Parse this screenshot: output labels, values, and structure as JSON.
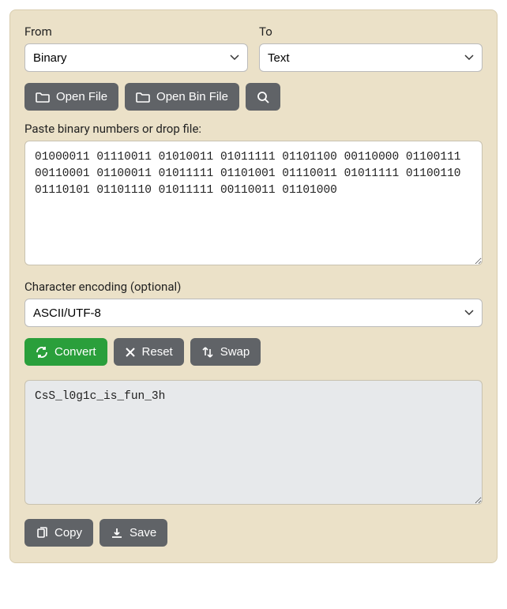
{
  "from": {
    "label": "From",
    "value": "Binary"
  },
  "to": {
    "label": "To",
    "value": "Text"
  },
  "buttons": {
    "open_file": "Open File",
    "open_bin_file": "Open Bin File"
  },
  "input": {
    "label": "Paste binary numbers or drop file:",
    "value": "01000011 01110011 01010011 01011111 01101100 00110000 01100111 00110001 01100011 01011111 01101001 01110011 01011111 01100110 01110101 01101110 01011111 00110011 01101000"
  },
  "encoding": {
    "label": "Character encoding (optional)",
    "value": "ASCII/UTF-8"
  },
  "actions": {
    "convert": "Convert",
    "reset": "Reset",
    "swap": "Swap"
  },
  "output": {
    "value": "CsS_l0g1c_is_fun_3h"
  },
  "footer": {
    "copy": "Copy",
    "save": "Save"
  }
}
